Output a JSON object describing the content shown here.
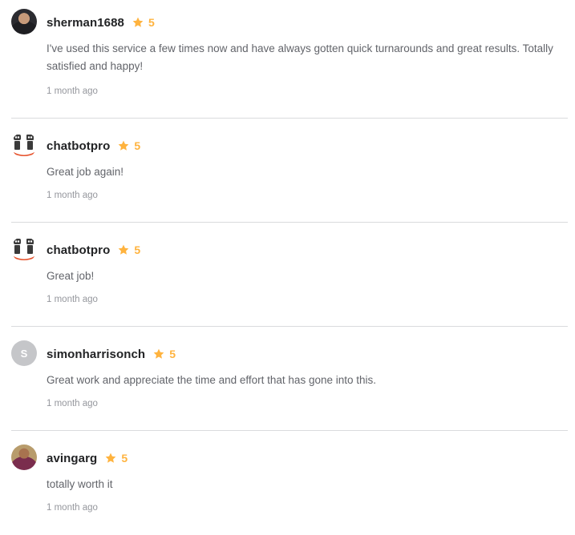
{
  "reviews": [
    {
      "username": "sherman1688",
      "rating": "5",
      "comment": "I've used this service a few times now and have always gotten quick turnarounds and great results. Totally satisfied and happy!",
      "time": "1 month ago",
      "avatar_type": "photo"
    },
    {
      "username": "chatbotpro",
      "rating": "5",
      "comment": "Great job again!",
      "time": "1 month ago",
      "avatar_type": "robot-logo"
    },
    {
      "username": "chatbotpro",
      "rating": "5",
      "comment": "Great job!",
      "time": "1 month ago",
      "avatar_type": "robot-logo"
    },
    {
      "username": "simonharrisonch",
      "rating": "5",
      "comment": "Great work and appreciate the time and effort that has gone into this.",
      "time": "1 month ago",
      "avatar_type": "letter",
      "avatar_letter": "S"
    },
    {
      "username": "avingarg",
      "rating": "5",
      "comment": "totally worth it",
      "time": "1 month ago",
      "avatar_type": "photo"
    }
  ],
  "colors": {
    "star": "#ffb33e",
    "username": "#222325",
    "comment": "#62646a",
    "time": "#95979d",
    "divider": "#dadbdd"
  },
  "icons": {
    "star": "star-icon"
  }
}
